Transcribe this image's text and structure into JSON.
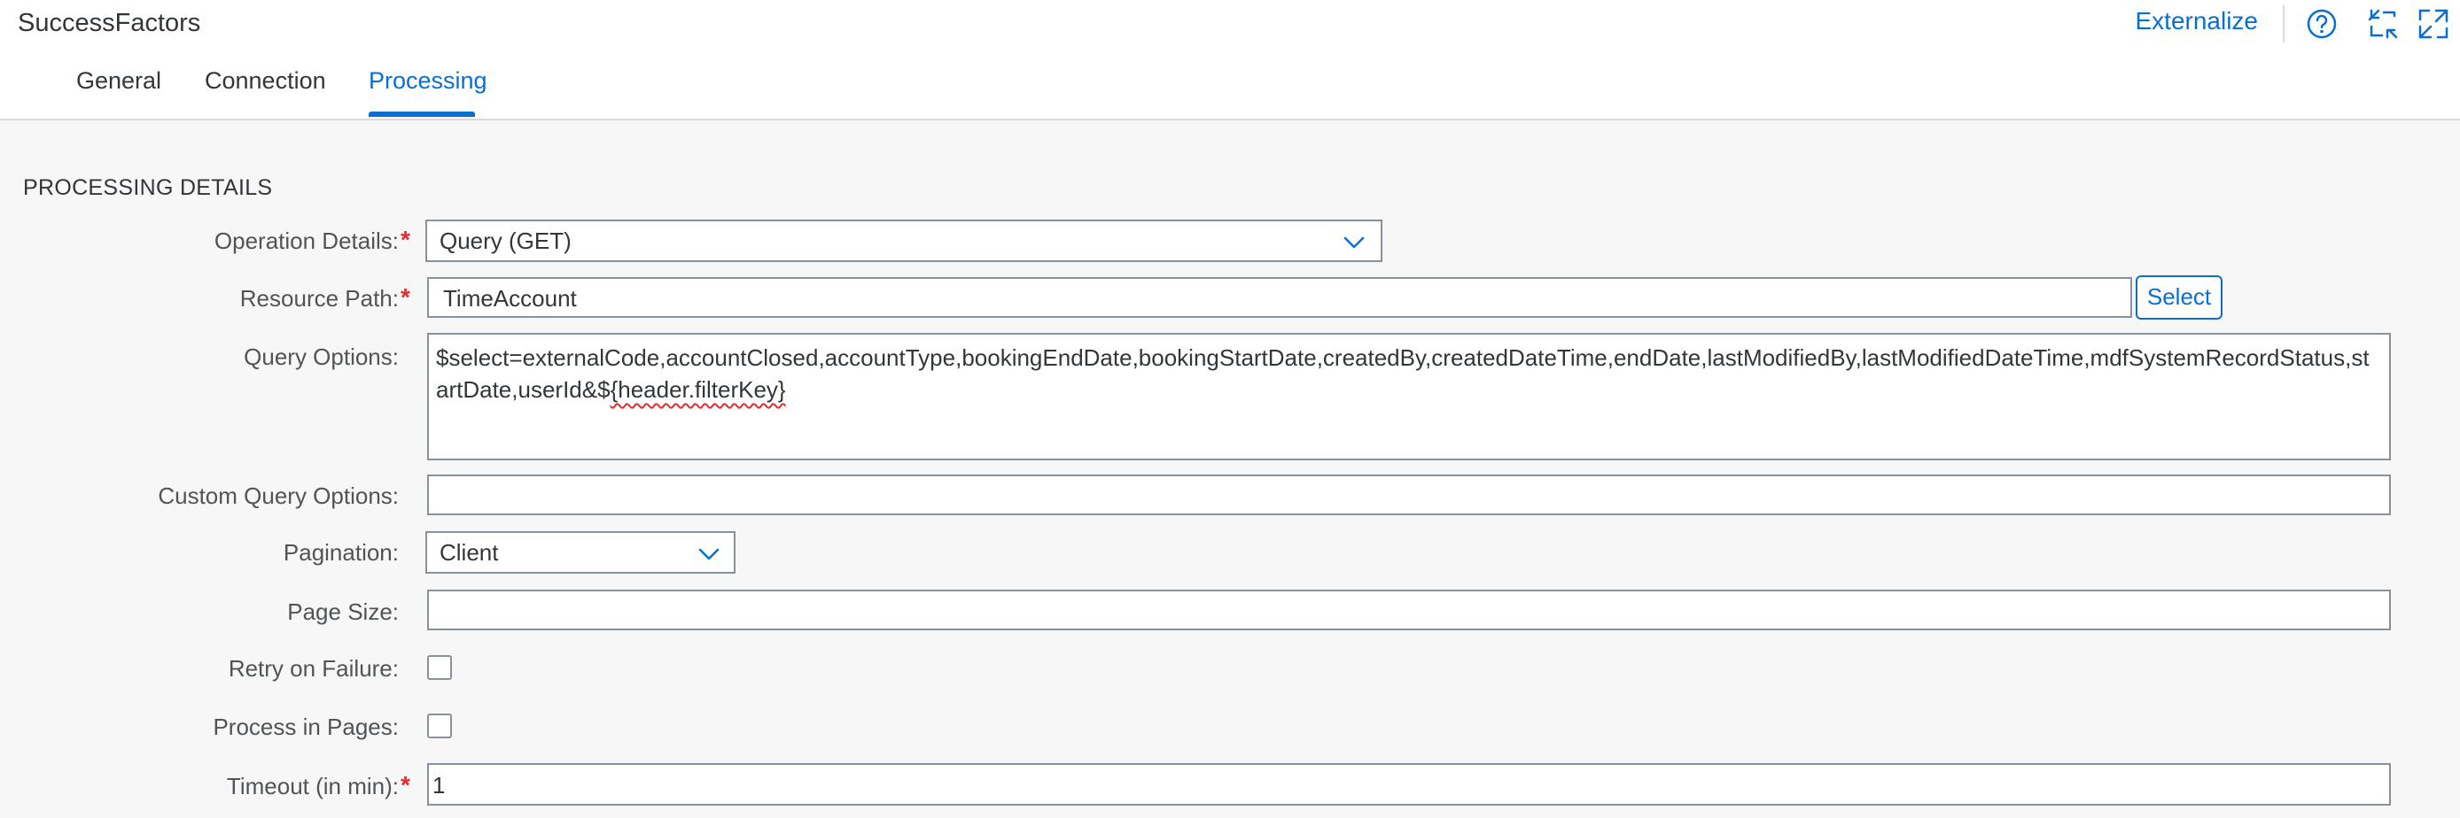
{
  "header": {
    "app_title": "SuccessFactors",
    "externalize_label": "Externalize",
    "icons": [
      "help-icon",
      "collapse-icon",
      "expand-icon"
    ]
  },
  "tabs": [
    {
      "label": "General",
      "active": false
    },
    {
      "label": "Connection",
      "active": false
    },
    {
      "label": "Processing",
      "active": true
    }
  ],
  "section": {
    "title": "PROCESSING DETAILS"
  },
  "form": {
    "operation_details": {
      "label": "Operation Details:",
      "required": true,
      "value": "Query (GET)"
    },
    "resource_path": {
      "label": "Resource Path:",
      "required": true,
      "value": "TimeAccount",
      "button_label": "Select"
    },
    "query_options": {
      "label": "Query Options:",
      "value_prefix": "$select=externalCode,accountClosed,accountType,bookingEndDate,bookingStartDate,createdBy,createdDateTime,endDate,lastModifiedBy,lastModifiedDateTime,mdfSystemRecordStatus,startDate,userId&$",
      "value_highlight": "{header.filterKey}"
    },
    "custom_query_options": {
      "label": "Custom Query Options:",
      "value": ""
    },
    "pagination": {
      "label": "Pagination:",
      "value": "Client"
    },
    "page_size": {
      "label": "Page Size:",
      "value": ""
    },
    "retry_on_failure": {
      "label": "Retry on Failure:",
      "checked": false
    },
    "process_in_pages": {
      "label": "Process in Pages:",
      "checked": false
    },
    "timeout": {
      "label": "Timeout (in min):",
      "required": true,
      "value": "1"
    }
  },
  "colors": {
    "accent": "#0a6ed1",
    "required": "#e02d2d",
    "border": "#89919a"
  }
}
